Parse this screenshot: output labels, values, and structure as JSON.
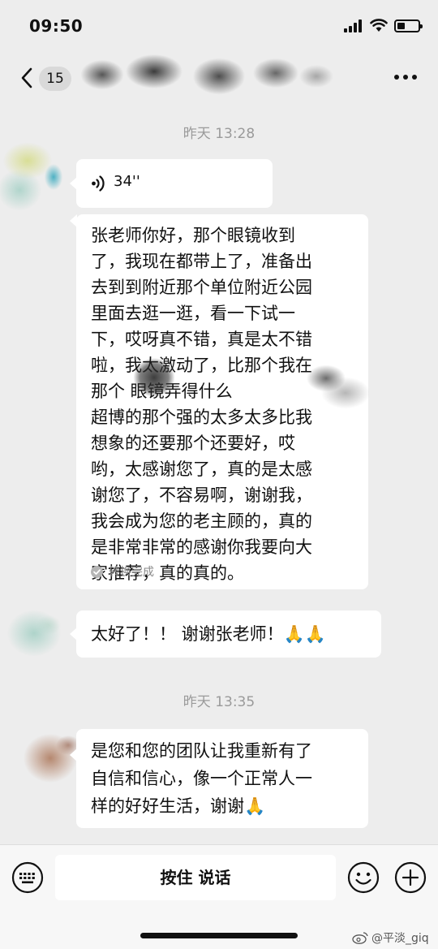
{
  "status_bar": {
    "time": "09:50"
  },
  "nav": {
    "unread_count": "15",
    "title_redacted": true
  },
  "timestamps": [
    "昨天 13:28",
    "昨天 13:35"
  ],
  "messages": {
    "voice": {
      "icon": "voice-wave-icon",
      "duration": "34''"
    },
    "transcript": {
      "lines": [
        "张老师你好，那个眼镜收到",
        "了，我现在都带上了，准备出",
        "去到到附近那个单位附近公园",
        "里面去逛一逛，看一下试一",
        "下，哎呀真不错，真是太不错",
        "啦，我太激动了，比那个我在",
        "那个  眼镜弄得什么",
        "超博的那个强的太多太多比我",
        "想象的还要那个还要好，哎",
        "哟，太感谢您了，真的是太感",
        "谢您了，不容易啊，谢谢我，",
        "我会成为您的老主顾的，真的",
        "是非常非常的感谢你我要向大",
        "家推荐，真的真的。"
      ],
      "status": "转换完成"
    },
    "reply1": {
      "text": "太好了！！ 谢谢张老师！🙏🙏"
    },
    "reply2": {
      "lines": [
        "是您和您的团队让我重新有了",
        "自信和信心，像一个正常人一",
        "样的好好生活，谢谢🙏"
      ]
    }
  },
  "input_bar": {
    "talk_label": "按住 说话"
  },
  "watermark": {
    "text": "@平淡_giq"
  },
  "colors": {
    "background": "#ededed",
    "bubble": "#ffffff",
    "timestamp": "#9a9a9a"
  }
}
